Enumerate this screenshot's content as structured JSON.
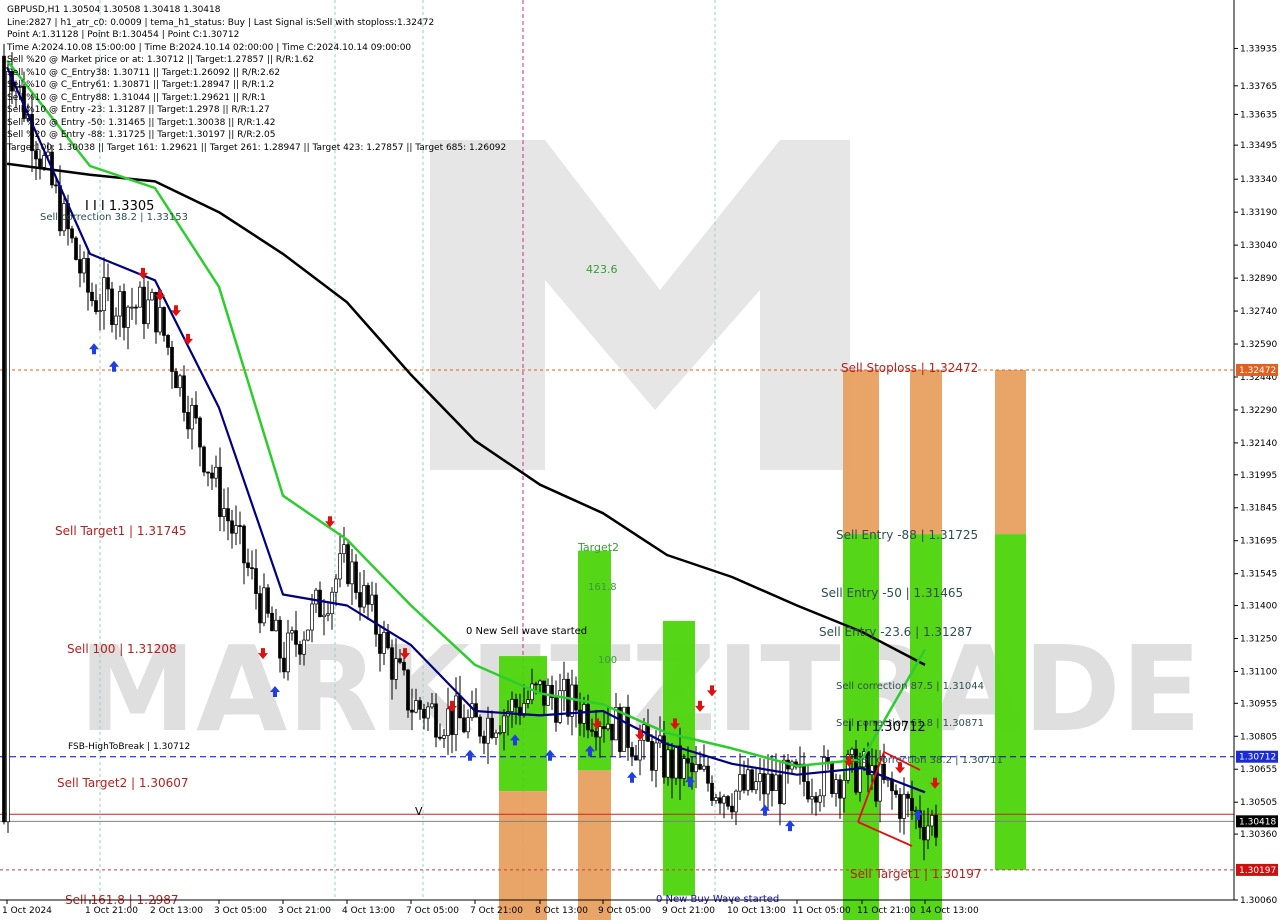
{
  "header": {
    "symbol_line": "GBPUSD,H1  1.30504 1.30508 1.30418 1.30418",
    "lines": [
      "Line:2827  |  h1_atr_c0: 0.0009  |  tema_h1_status: Buy  |  Last Signal is:Sell with stoploss:1.32472",
      "Point A:1.31128  |  Point B:1.30454  |  Point C:1.30712",
      "Time A:2024.10.08 15:00:00  |  Time B:2024.10.14 02:00:00  |  Time C:2024.10.14 09:00:00",
      "Sell %20 @ Market price or at: 1.30712  ||  Target:1.27857  ||  R/R:1.62",
      "Sell %10 @ C_Entry38: 1.30711  ||  Target:1.26092  ||  R/R:2.62",
      "Sell %10 @ C_Entry61: 1.30871  ||  Target:1.28947  ||  R/R:1.2",
      "Sell %10 @ C_Entry88: 1.31044  ||  Target:1.29621  ||  R/R:1",
      "Sell %10 @ Entry -23: 1.31287  ||  Target:1.2978  ||  R/R:1.27",
      "Sell %20 @ Entry -50: 1.31465  ||  Target:1.30038  ||  R/R:1.42",
      "Sell %20 @ Entry -88: 1.31725  ||  Target:1.30197  ||  R/R:2.05",
      "Target100: 1.30038  ||  Target 161: 1.29621  ||  Target 261: 1.28947  ||  Target 423: 1.27857  ||  Target 685: 1.26092"
    ]
  },
  "colors": {
    "sell_label": "#b22222",
    "entry_label": "#2f4f4f",
    "green_ma": "#2ecc2e",
    "blue_ma": "#000080",
    "black_ma": "#000000",
    "box_green": "#4cd40a",
    "box_orange": "#e8a060",
    "fsb_line": "#0000cc",
    "stoploss_line": "#e06020",
    "price_tag_red": "#e01010",
    "price_tag_blue": "#1b2bd6"
  },
  "chart_data": {
    "type": "candlestick",
    "symbol": "GBPUSD",
    "timeframe": "H1",
    "ylim": [
      1.3006,
      1.3411
    ],
    "y_ticks": [
      "1.33935",
      "1.33765",
      "1.33635",
      "1.33495",
      "1.33340",
      "1.33190",
      "1.33040",
      "1.32890",
      "1.32740",
      "1.32590",
      "1.32440",
      "1.32290",
      "1.32140",
      "1.31995",
      "1.31845",
      "1.31695",
      "1.31545",
      "1.31400",
      "1.31250",
      "1.31100",
      "1.30955",
      "1.30805",
      "1.30655",
      "1.30505",
      "1.30360",
      "1.30060"
    ],
    "x_ticks": [
      "1 Oct 2024",
      "1 Oct 21:00",
      "2 Oct 13:00",
      "3 Oct 05:00",
      "3 Oct 21:00",
      "4 Oct 13:00",
      "7 Oct 05:00",
      "7 Oct 21:00",
      "8 Oct 13:00",
      "9 Oct 05:00",
      "9 Oct 21:00",
      "10 Oct 13:00",
      "11 Oct 05:00",
      "11 Oct 21:00",
      "14 Oct 13:00"
    ],
    "close_path": [
      [
        "1 Oct 2024",
        1.339
      ],
      [
        "1 Oct 21:00",
        1.328
      ],
      [
        "2 Oct 13:00",
        1.3275
      ],
      [
        "3 Oct 05:00",
        1.319
      ],
      [
        "3 Oct 21:00",
        1.3115
      ],
      [
        "4 Oct 13:00",
        1.316
      ],
      [
        "7 Oct 05:00",
        1.3095
      ],
      [
        "7 Oct 21:00",
        1.3085
      ],
      [
        "8 Oct 13:00",
        1.31
      ],
      [
        "9 Oct 05:00",
        1.309
      ],
      [
        "9 Oct 21:00",
        1.3068
      ],
      [
        "10 Oct 13:00",
        1.3055
      ],
      [
        "11 Oct 05:00",
        1.306
      ],
      [
        "11 Oct 21:00",
        1.3065
      ],
      [
        "14 Oct 13:00",
        1.30418
      ]
    ],
    "ma_black": [
      [
        "1 Oct 2024",
        1.3341
      ],
      [
        "1 Oct 21:00",
        1.3336
      ],
      [
        "2 Oct 13:00",
        1.3333
      ],
      [
        "3 Oct 05:00",
        1.3319
      ],
      [
        "3 Oct 21:00",
        1.33
      ],
      [
        "4 Oct 13:00",
        1.3278
      ],
      [
        "7 Oct 05:00",
        1.3245
      ],
      [
        "7 Oct 21:00",
        1.3215
      ],
      [
        "8 Oct 13:00",
        1.3195
      ],
      [
        "9 Oct 05:00",
        1.3182
      ],
      [
        "9 Oct 21:00",
        1.3163
      ],
      [
        "10 Oct 13:00",
        1.3153
      ],
      [
        "11 Oct 05:00",
        1.314
      ],
      [
        "11 Oct 21:00",
        1.3128
      ],
      [
        "14 Oct 13:00",
        1.3113
      ]
    ],
    "ma_green": [
      [
        "1 Oct 2024",
        1.3388
      ],
      [
        "1 Oct 21:00",
        1.334
      ],
      [
        "2 Oct 13:00",
        1.333
      ],
      [
        "3 Oct 05:00",
        1.3285
      ],
      [
        "3 Oct 21:00",
        1.319
      ],
      [
        "4 Oct 13:00",
        1.317
      ],
      [
        "7 Oct 05:00",
        1.314
      ],
      [
        "7 Oct 21:00",
        1.3113
      ],
      [
        "8 Oct 13:00",
        1.31
      ],
      [
        "9 Oct 05:00",
        1.3095
      ],
      [
        "9 Oct 21:00",
        1.3082
      ],
      [
        "10 Oct 13:00",
        1.3075
      ],
      [
        "11 Oct 05:00",
        1.3067
      ],
      [
        "11 Oct 21:00",
        1.307
      ],
      [
        "14 Oct 13:00",
        1.312
      ]
    ],
    "ma_blue": [
      [
        "1 Oct 2024",
        1.3385
      ],
      [
        "1 Oct 21:00",
        1.33
      ],
      [
        "2 Oct 13:00",
        1.3288
      ],
      [
        "3 Oct 05:00",
        1.323
      ],
      [
        "3 Oct 21:00",
        1.3145
      ],
      [
        "4 Oct 13:00",
        1.314
      ],
      [
        "7 Oct 05:00",
        1.3122
      ],
      [
        "7 Oct 21:00",
        1.3092
      ],
      [
        "8 Oct 13:00",
        1.309
      ],
      [
        "9 Oct 05:00",
        1.3092
      ],
      [
        "9 Oct 21:00",
        1.3077
      ],
      [
        "10 Oct 13:00",
        1.3068
      ],
      [
        "11 Oct 05:00",
        1.3063
      ],
      [
        "11 Oct 21:00",
        1.3066
      ],
      [
        "14 Oct 13:00",
        1.3055
      ]
    ],
    "levels": [
      {
        "name": "Sell Stoploss",
        "value": 1.32472,
        "tag": "1.32472"
      },
      {
        "name": "FSB-HighToBreak",
        "value": 1.30712,
        "tag": "1.30712"
      },
      {
        "name": "Current price",
        "value": 1.30418,
        "tag": "1.30418"
      },
      {
        "name": "Sell Target1",
        "value": 1.30197,
        "tag": "1.30197"
      }
    ],
    "labels": {
      "sell_target1_left": "Sell Target1 | 1.31745",
      "sell_100": "Sell 100 | 1.31208",
      "sell_target2": "Sell Target2 | 1.30607",
      "fsb": "FSB-HighToBreak | 1.30712",
      "sell_correction_left": "Sell correction 38.2 | 1.33153",
      "price_1_3305": "I I I 1.3305",
      "n_423": "423.6",
      "target2": "Target2",
      "n_161": "161.8",
      "n_100": "100",
      "new_sell_wave": "0 New Sell wave started",
      "new_buy_wave": "0 New Buy Wave started",
      "sell_stoploss": "Sell Stoploss | 1.32472",
      "sell_entry_88": "Sell Entry -88 | 1.31725",
      "sell_entry_50": "Sell Entry -50 | 1.31465",
      "sell_entry_23": "Sell Entry -23.6 | 1.31287",
      "sell_corr_87": "Sell correction 87.5 | 1.31044",
      "sell_corr_61": "Sell correction 61.8 | 1.30871",
      "sell_corr_38": "Sell correction 38.2 | 1.30711",
      "sell_target1_right": "Sell Target1 | 1.30197",
      "i_1_30712": "I I I 1.30712",
      "v_mark": "V",
      "bottom_left_cut": "Sell 161.8 | 1.2987"
    },
    "grid": false
  }
}
